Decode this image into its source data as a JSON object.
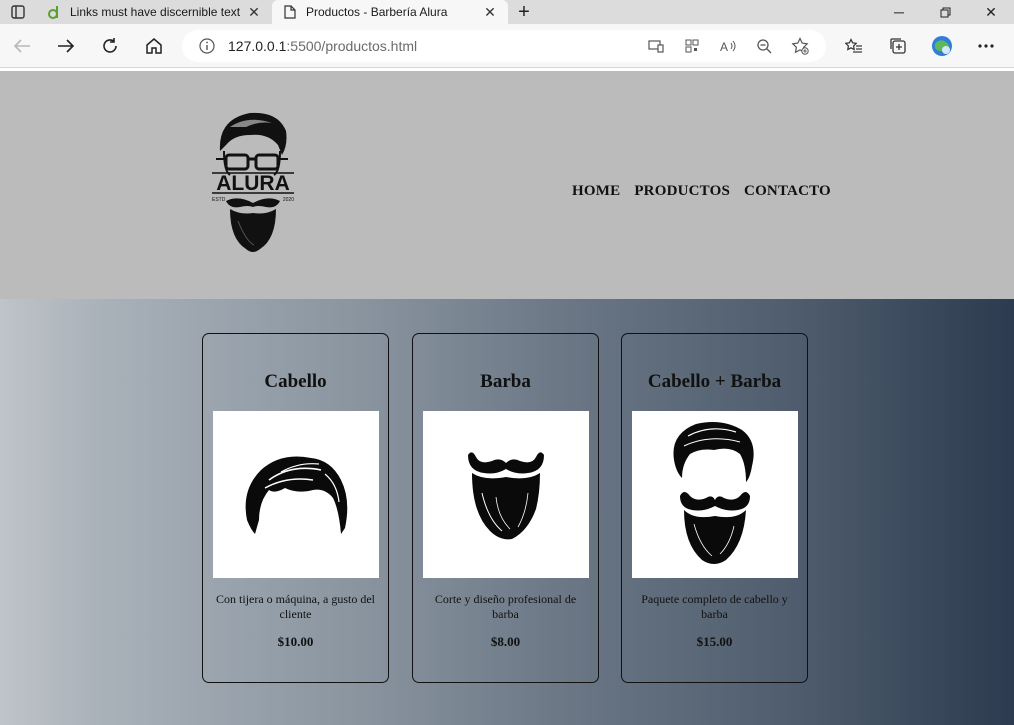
{
  "browser": {
    "tabs": [
      {
        "title": "Links must have discernible text |",
        "active": false,
        "favicon": "deque-d-icon"
      },
      {
        "title": "Productos - Barbería Alura",
        "active": true,
        "favicon": "page-icon"
      }
    ],
    "new_tab": "+",
    "window_controls": [
      "minimize-icon",
      "restore-icon",
      "close-icon"
    ],
    "address": {
      "host": "127.0.0.1",
      "rest": ":5500/productos.html"
    },
    "accent_color": "#1a73e8"
  },
  "site": {
    "logo": {
      "text": "ALURA",
      "left": "ESTD",
      "right": "2020"
    },
    "nav": [
      {
        "label": "HOME"
      },
      {
        "label": "PRODUCTOS"
      },
      {
        "label": "CONTACTO"
      }
    ],
    "header_color": "#bbbbbb",
    "products": [
      {
        "title": "Cabello",
        "image": "hair-icon",
        "description": "Con tijera o máquina, a gusto del cliente",
        "price": "$10.00"
      },
      {
        "title": "Barba",
        "image": "beard-icon",
        "description": "Corte y diseño profesional de barba",
        "price": "$8.00"
      },
      {
        "title": "Cabello + Barba",
        "image": "hair-beard-icon",
        "description": "Paquete completo de cabello y barba",
        "price": "$15.00"
      }
    ]
  }
}
